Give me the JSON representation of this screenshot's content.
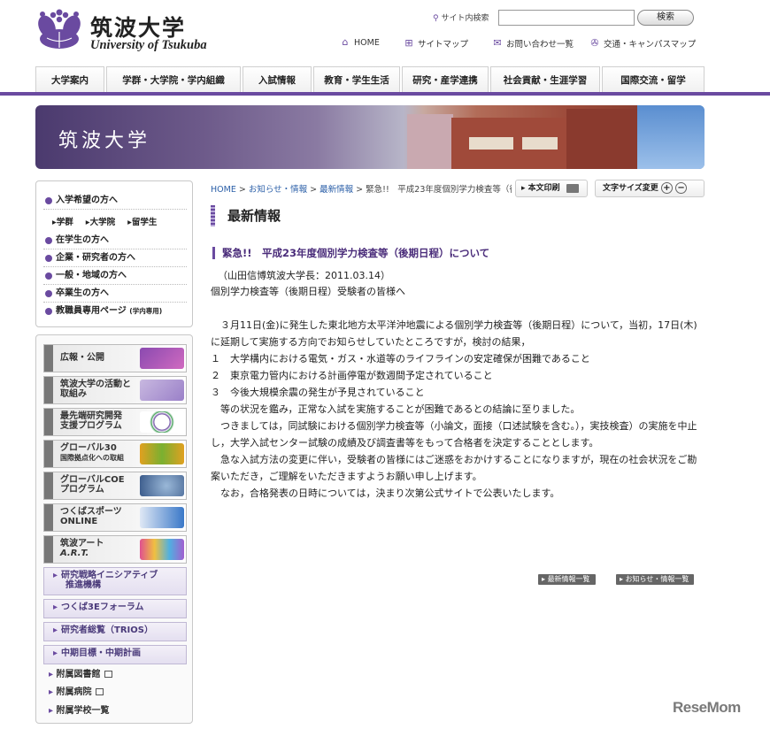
{
  "header": {
    "logo_jp": "筑波大学",
    "logo_en": "University of Tsukuba",
    "search_label": "サイト内検索",
    "search_value": "",
    "search_button": "検索",
    "util_links": [
      {
        "label": "HOME",
        "icon": "home-icon"
      },
      {
        "label": "サイトマップ",
        "icon": "sitemap-icon"
      },
      {
        "label": "お問い合わせ一覧",
        "icon": "mail-icon"
      },
      {
        "label": "交通・キャンパスマップ",
        "icon": "map-icon"
      }
    ]
  },
  "gnav": [
    "大学案内",
    "学群・大学院・学内組織",
    "入試情報",
    "教育・学生生活",
    "研究・産学連携",
    "社会貢献・生涯学習",
    "国際交流・留学"
  ],
  "banner": {
    "title": "筑波大学"
  },
  "sidebar": {
    "audience": [
      {
        "label": "入学希望の方へ"
      },
      {
        "label": "在学生の方へ"
      },
      {
        "label": "企業・研究者の方へ"
      },
      {
        "label": "一般・地域の方へ"
      },
      {
        "label": "卒業生の方へ"
      },
      {
        "label": "教職員専用ページ",
        "note": "(学内専用)"
      }
    ],
    "sub_links": [
      "学群",
      "大学院",
      "留学生"
    ],
    "banners": [
      {
        "l1": "広報・公開",
        "l2": ""
      },
      {
        "l1": "筑波大学の活動と",
        "l2": "取組み"
      },
      {
        "l1": "最先端研究開発",
        "l2": "支援プログラム"
      },
      {
        "l1": "グローバル30",
        "l2": "国際拠点化への取組"
      },
      {
        "l1": "グローバルCOE",
        "l2": "プログラム"
      },
      {
        "l1": "つくばスポーツ",
        "l2": "ONLINE"
      },
      {
        "l1": "筑波アート",
        "l2": "A.R.T."
      }
    ],
    "text_banners": [
      {
        "l1": "研究戦略イニシアティブ",
        "l2": "推進機構"
      },
      {
        "l1": "つくば3Eフォーラム",
        "l2": ""
      },
      {
        "l1": "研究者総覧（TRIOS）",
        "l2": ""
      },
      {
        "l1": "中期目標・中期計画",
        "l2": ""
      }
    ],
    "links": [
      "附属図書館",
      "附属病院",
      "附属学校一覧"
    ]
  },
  "breadcrumb": {
    "home": "HOME",
    "l1": "お知らせ・情報",
    "l2": "最新情報",
    "current": "緊急!!　平成23年度個別学力検査等（後期日程）について"
  },
  "tools": {
    "print": "本文印刷",
    "fontsize": "文字サイズ変更",
    "plus": "+",
    "minus": "−"
  },
  "main": {
    "page_title": "最新情報",
    "article_title": "緊急!!　平成23年度個別学力検査等（後期日程）について",
    "meta": "（山田信博筑波大学長：2011.03.14）",
    "greeting": "個別学力検査等（後期日程）受験者の皆様へ",
    "paragraphs": [
      "　３月11日(金)に発生した東北地方太平洋沖地震による個別学力検査等（後期日程）について，当初，17日(木)に延期して実施する方向でお知らせしていたところですが，検討の結果，",
      "１　大学構内における電気・ガス・水道等のライフラインの安定確保が困難であること",
      "２　東京電力管内における計画停電が数週間予定されていること",
      "３　今後大規模余震の発生が予見されていること",
      "　等の状況を鑑み，正常な入試を実施することが困難であるとの結論に至りました。",
      "　つきましては，同試験における個別学力検査等（小論文，面接（口述試験を含む。），実技検査）の実施を中止し，大学入試センター試験の成績及び調査書等をもって合格者を決定することとします。",
      "　急な入試方法の変更に伴い，受験者の皆様にはご迷惑をおかけすることになりますが，現在の社会状況をご勘案いただき，ご理解をいただきますようお願い申し上げます。",
      "　なお，合格発表の日時については，決まり次第公式サイトで公表いたします。"
    ],
    "footer_links": [
      "最新情報一覧",
      "お知らせ・情報一覧"
    ]
  },
  "watermark": "ReseMom"
}
